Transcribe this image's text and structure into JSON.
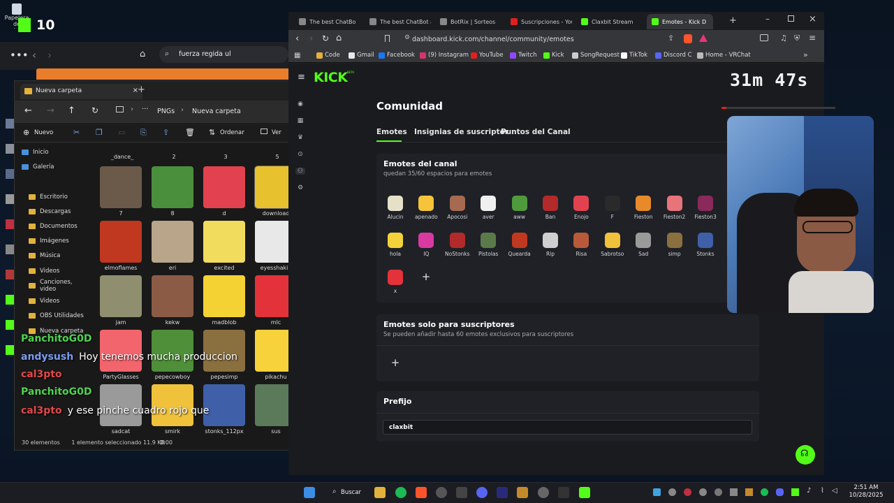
{
  "desktop": {
    "recycle_label": "Papelera de reciclaje",
    "counter": "10"
  },
  "back_browser": {
    "search_text": "fuerza regida ul"
  },
  "explorer": {
    "tab_title": "Nueva carpeta",
    "breadcrumb": [
      "PNGs",
      "Nueva carpeta"
    ],
    "toolbar": {
      "new_label": "Nuevo",
      "sort_label": "Ordenar",
      "view_label": "Ver"
    },
    "sidebar": [
      "Inicio",
      "Galería",
      "Escritorio",
      "Descargas",
      "Documentos",
      "Imágenes",
      "Música",
      "Videos",
      "Canciones, video",
      "Videos",
      "OBS Utilidades",
      "Nueva carpeta"
    ],
    "top_row_labels": [
      "_dance_",
      "2",
      "3",
      "5"
    ],
    "files": [
      {
        "name": "7",
        "color": "#6b5a4a"
      },
      {
        "name": "8",
        "color": "#4a8f3c"
      },
      {
        "name": "d",
        "color": "#e2424f"
      },
      {
        "name": "download",
        "color": "#e8c12e"
      },
      {
        "name": "elmoflames",
        "color": "#c0381f"
      },
      {
        "name": "eri",
        "color": "#b9a58a"
      },
      {
        "name": "excited",
        "color": "#f2dc5d"
      },
      {
        "name": "eyesshakin",
        "color": "#e8e8e8"
      },
      {
        "name": "jam",
        "color": "#8f8f70"
      },
      {
        "name": "kekw",
        "color": "#8b5b46"
      },
      {
        "name": "madblob",
        "color": "#f5d233"
      },
      {
        "name": "mlc",
        "color": "#e3323a"
      },
      {
        "name": "PartyGlasses",
        "color": "#f2656d"
      },
      {
        "name": "pepecowboy",
        "color": "#4f8f3a"
      },
      {
        "name": "pepesimp",
        "color": "#8a6f3f"
      },
      {
        "name": "pikachu",
        "color": "#f7d23a"
      },
      {
        "name": "sadcat",
        "color": "#9a9a9a"
      },
      {
        "name": "smirk",
        "color": "#f0c23c"
      },
      {
        "name": "stonks_112px",
        "color": "#3f5fa8"
      },
      {
        "name": "sus",
        "color": "#5a7a5a"
      }
    ],
    "status_count": "30 elementos",
    "status_selected": "1 elemento seleccionado  11.9 KB",
    "status_time": "0:00"
  },
  "chat": [
    {
      "user": "PanchitoG0D",
      "message": "",
      "color": "green"
    },
    {
      "user": "andysush",
      "message": "Hoy tenemos mucha produccion",
      "color": "blue"
    },
    {
      "user": "cal3pto",
      "message": "",
      "color": "red"
    },
    {
      "user": "PanchitoG0D",
      "message": "",
      "color": "green"
    },
    {
      "user": "cal3pto",
      "message": "y ese pinche cuadro rojo que",
      "color": "red"
    }
  ],
  "browser": {
    "tabs": [
      {
        "title": "The best ChatBo",
        "color": "#888"
      },
      {
        "title": "The best ChatBot an",
        "color": "#888"
      },
      {
        "title": "BotRix | Sorteos",
        "color": "#888"
      },
      {
        "title": "Suscripciones - You",
        "color": "#e02020"
      },
      {
        "title": "Claxbit Stream",
        "color": "#53fc18"
      },
      {
        "title": "Emotes - Kick D",
        "color": "#53fc18"
      }
    ],
    "url": "dashboard.kick.com/channel/community/emotes",
    "bookmarks": [
      {
        "label": "Code",
        "color": "#e3b23c"
      },
      {
        "label": "Gmail",
        "color": "#e8e8e8"
      },
      {
        "label": "Facebook",
        "color": "#1877f2"
      },
      {
        "label": "(9) Instagram",
        "color": "#d6336c"
      },
      {
        "label": "YouTube",
        "color": "#e02020"
      },
      {
        "label": "Twitch",
        "color": "#9146ff"
      },
      {
        "label": "Kick",
        "color": "#53fc18"
      },
      {
        "label": "SongRequest",
        "color": "#cccccc"
      },
      {
        "label": "TikTok",
        "color": "#ffffff"
      },
      {
        "label": "Discord C",
        "color": "#5865f2"
      },
      {
        "label": "Home - VRChat",
        "color": "#bbbbbb"
      }
    ]
  },
  "page": {
    "logo": "KICK",
    "logo_badge": "BETA",
    "title": "Comunidad",
    "tabs": [
      "Emotes",
      "Insignias de suscriptor",
      "Puntos del Canal"
    ],
    "channel_emotes": {
      "title": "Emotes del canal",
      "subtitle": "quedan 35/60 espacios para emotes",
      "emotes": [
        {
          "name": "Alucin",
          "color": "#e6e0c8"
        },
        {
          "name": "apenado",
          "color": "#f5c43a"
        },
        {
          "name": "Apocosi",
          "color": "#a56a50"
        },
        {
          "name": "aver",
          "color": "#f0f0f0"
        },
        {
          "name": "aww",
          "color": "#4f9a3c"
        },
        {
          "name": "Ban",
          "color": "#b22a2a"
        },
        {
          "name": "Enojo",
          "color": "#e2424f"
        },
        {
          "name": "F",
          "color": "#2a2a2a"
        },
        {
          "name": "Fieston",
          "color": "#e88a2a"
        },
        {
          "name": "Fieston2",
          "color": "#e8737a"
        },
        {
          "name": "Fieston3",
          "color": "#8a2a5a"
        },
        {
          "name": "hola",
          "color": "#f2d23a"
        },
        {
          "name": "IQ",
          "color": "#d83aa0"
        },
        {
          "name": "NoStonks",
          "color": "#b22a2a"
        },
        {
          "name": "Pistolas",
          "color": "#5a7a4a"
        },
        {
          "name": "Quearda",
          "color": "#c0381f"
        },
        {
          "name": "Rip",
          "color": "#cfcfcf"
        },
        {
          "name": "Risa",
          "color": "#b85a3a"
        },
        {
          "name": "Sabrotso",
          "color": "#f0c23c"
        },
        {
          "name": "Sad",
          "color": "#9a9a9a"
        },
        {
          "name": "simp",
          "color": "#8a6f3f"
        },
        {
          "name": "Stonks",
          "color": "#3f5fa8"
        },
        {
          "name": "x",
          "color": "#e3323a"
        }
      ],
      "add_label": "+"
    },
    "sub_emotes": {
      "title": "Emotes solo para suscriptores",
      "subtitle": "Se pueden añadir hasta 60 emotes exclusivos para suscriptores",
      "add_label": "+"
    },
    "prefix": {
      "title": "Prefijo",
      "value": "claxbit"
    }
  },
  "stream_overlay": {
    "timer": "31m 47s",
    "progress_fraction": 0.04
  },
  "taskbar": {
    "search_label": "Buscar",
    "time": "2:51 AM",
    "date": "10/28/2025"
  },
  "colors": {
    "kick_green": "#53fc18",
    "page_bg": "#191b1f",
    "card_bg": "#1f2127"
  }
}
